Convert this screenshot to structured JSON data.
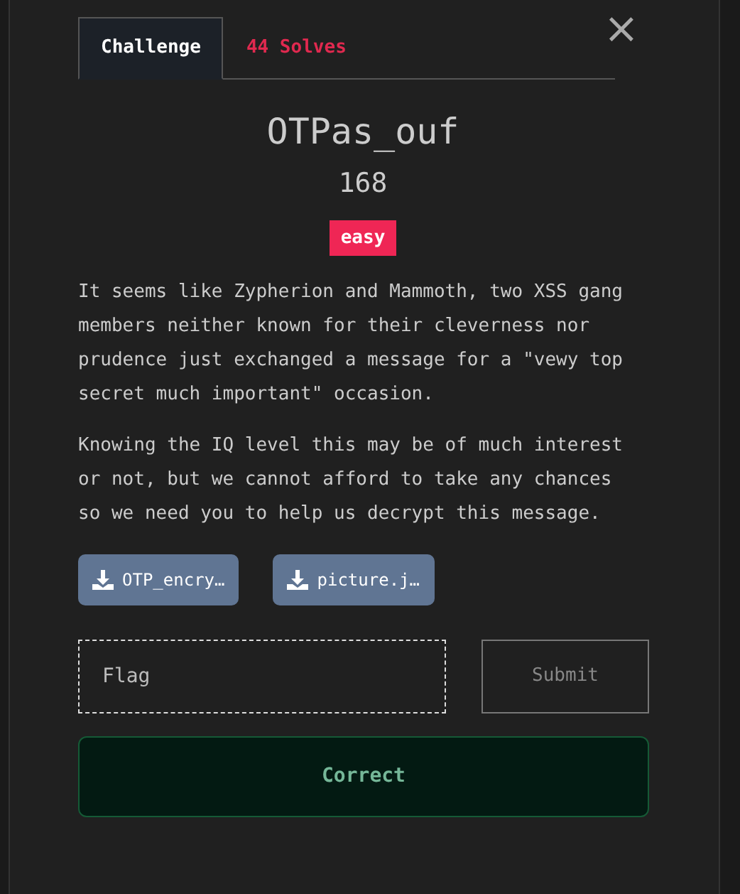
{
  "tabs": [
    {
      "label": "Challenge",
      "selected": true
    },
    {
      "label": "44 Solves",
      "selected": false
    }
  ],
  "close": "×",
  "challenge": {
    "name": "OTPas_ouf",
    "value": "168",
    "difficulty": "easy"
  },
  "description": [
    "It seems like Zypherion and Mammoth, two XSS gang members neither known for their cleverness nor prudence just exchanged a message for a \"vewy top secret much important\" occasion.",
    "Knowing the IQ level this may be of much interest or not, but we cannot afford to take any chances so we need you to help us decrypt this message."
  ],
  "files": [
    {
      "label": "OTP_encry…"
    },
    {
      "label": "picture.j…"
    }
  ],
  "flag_field": {
    "placeholder": "Flag"
  },
  "submit": {
    "label": "Submit",
    "disabled": true
  },
  "result": {
    "label": "Correct",
    "correct": true
  }
}
